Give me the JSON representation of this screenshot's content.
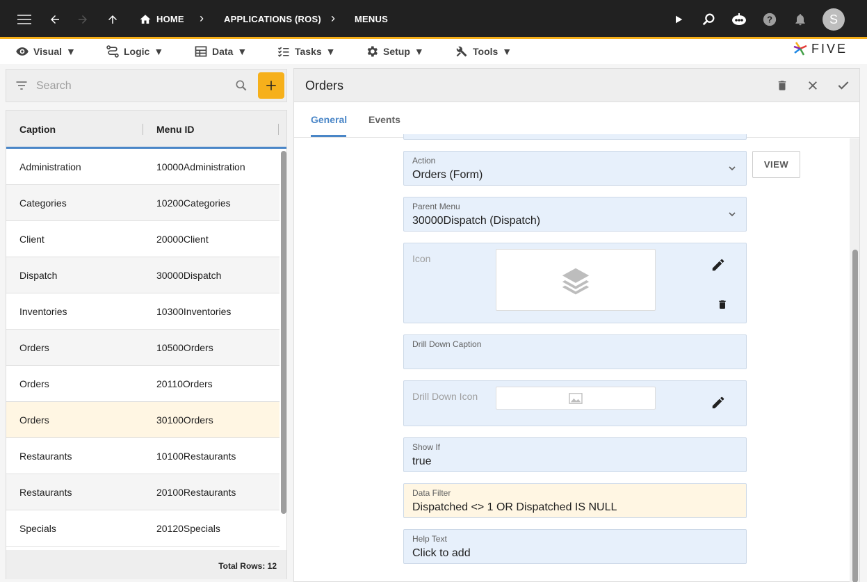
{
  "topbar": {
    "breadcrumbs": [
      "HOME",
      "APPLICATIONS (ROS)",
      "MENUS"
    ],
    "avatar_initial": "S"
  },
  "menubar": {
    "items": [
      {
        "label": "Visual",
        "icon": "eye-icon"
      },
      {
        "label": "Logic",
        "icon": "logic-icon"
      },
      {
        "label": "Data",
        "icon": "table-icon"
      },
      {
        "label": "Tasks",
        "icon": "tasks-icon"
      },
      {
        "label": "Setup",
        "icon": "gear-icon"
      },
      {
        "label": "Tools",
        "icon": "tools-icon"
      }
    ],
    "logo_text": "FIVE"
  },
  "search": {
    "placeholder": "Search"
  },
  "list": {
    "columns": [
      "Caption",
      "Menu ID"
    ],
    "rows": [
      {
        "caption": "Administration",
        "menu_id": "10000Administration"
      },
      {
        "caption": "Categories",
        "menu_id": "10200Categories"
      },
      {
        "caption": "Client",
        "menu_id": "20000Client"
      },
      {
        "caption": "Dispatch",
        "menu_id": "30000Dispatch"
      },
      {
        "caption": "Inventories",
        "menu_id": "10300Inventories"
      },
      {
        "caption": "Orders",
        "menu_id": "10500Orders"
      },
      {
        "caption": "Orders",
        "menu_id": "20110Orders"
      },
      {
        "caption": "Orders",
        "menu_id": "30100Orders"
      },
      {
        "caption": "Restaurants",
        "menu_id": "10100Restaurants"
      },
      {
        "caption": "Restaurants",
        "menu_id": "20100Restaurants"
      },
      {
        "caption": "Specials",
        "menu_id": "20120Specials"
      }
    ],
    "selected_index": 7,
    "footer": "Total Rows: 12"
  },
  "form": {
    "title": "Orders",
    "tabs": [
      "General",
      "Events"
    ],
    "active_tab": "General",
    "fields": {
      "action": {
        "label": "Action",
        "value": "Orders (Form)"
      },
      "view_button": "VIEW",
      "parent_menu": {
        "label": "Parent Menu",
        "value": "30000Dispatch (Dispatch)"
      },
      "icon": {
        "label": "Icon"
      },
      "drill_down_caption": {
        "label": "Drill Down Caption",
        "value": ""
      },
      "drill_down_icon": {
        "label": "Drill Down Icon"
      },
      "show_if": {
        "label": "Show If",
        "value": "true"
      },
      "data_filter": {
        "label": "Data Filter",
        "value": "Dispatched <> 1 OR Dispatched IS NULL"
      },
      "help_text": {
        "label": "Help Text",
        "value": "Click to add"
      }
    }
  },
  "colors": {
    "accent": "#f6b01b",
    "tab_active": "#4a86c7",
    "field_bg": "#e7f0fb",
    "field_warn_bg": "#fff6e3"
  }
}
